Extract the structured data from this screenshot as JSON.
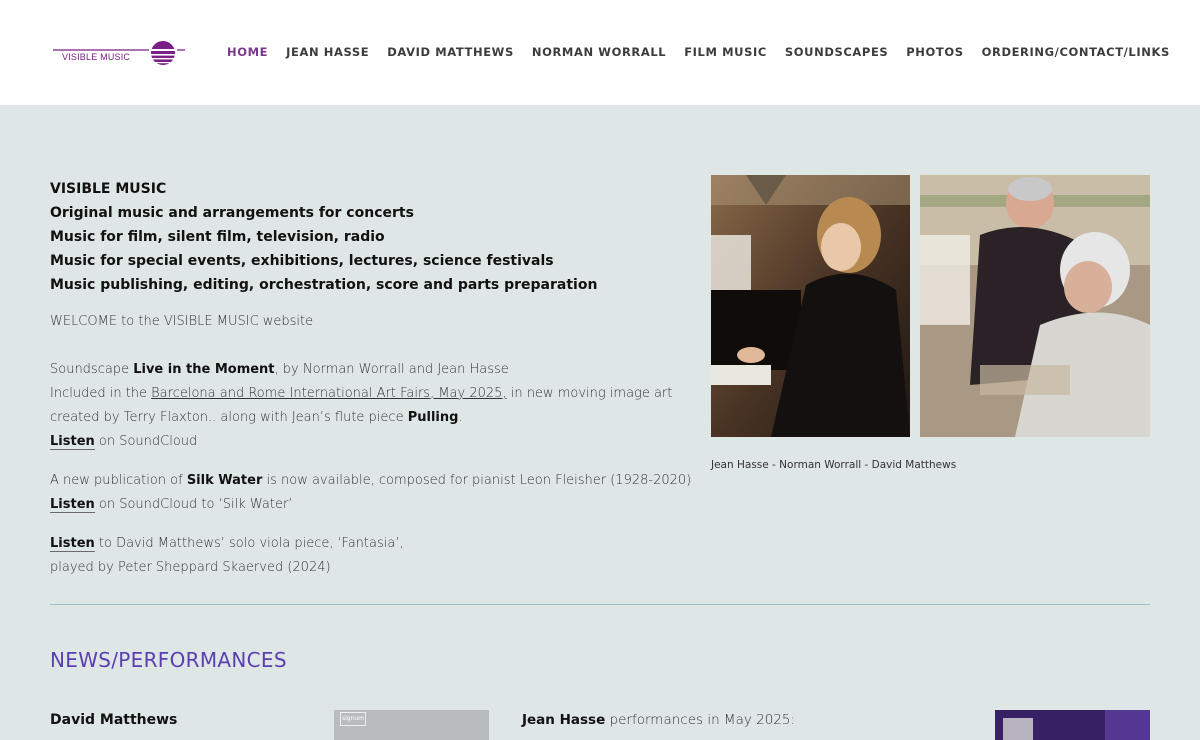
{
  "logo": {
    "text": "VISIBLE MUSIC",
    "color": "#7a1f86"
  },
  "nav": {
    "items": [
      {
        "label": "HOME",
        "active": true
      },
      {
        "label": "JEAN HASSE"
      },
      {
        "label": "DAVID MATTHEWS"
      },
      {
        "label": "NORMAN WORRALL"
      },
      {
        "label": "FILM MUSIC"
      },
      {
        "label": "SOUNDSCAPES"
      },
      {
        "label": "PHOTOS"
      },
      {
        "label": "ORDERING/CONTACT/LINKS"
      }
    ]
  },
  "intro": {
    "lines": [
      "VISIBLE MUSIC",
      "Original music and arrangements for concerts",
      "Music for film, silent film, television, radio",
      "Music for special events, exhibitions, lectures, science festivals",
      "Music publishing, editing, orchestration, score and parts preparation"
    ]
  },
  "welcome": "WELCOME to the VISIBLE MUSIC website",
  "soundscape": {
    "prefix": "Soundscape ",
    "title": "Live in the Moment",
    "suffix": ", by Norman Worrall and Jean Hasse",
    "line2_prefix": "Included in the ",
    "line2_link": "Barcelona and Rome International Art Fairs, May 2025,",
    "line2_suffix": " in new moving image art",
    "line3_prefix": "created by Terry Flaxton.. along with Jean’s flute piece ",
    "line3_bold": "Pulling",
    "line3_suffix": ".",
    "listen": "Listen",
    "listen_suffix": " on SoundCloud"
  },
  "silk_water": {
    "prefix": "A new publication of ",
    "title": "Silk Water",
    "suffix": " is now available, composed for pianist Leon Fleisher (1928-2020)",
    "listen": "Listen",
    "listen_suffix": " on SoundCloud to ‘Silk Water’"
  },
  "fantasia": {
    "listen": "Listen",
    "line1_suffix": " to David Matthews’ solo viola piece, ‘Fantasia’,",
    "line2": "played by Peter Sheppard Skaerved (2024)"
  },
  "photo_caption": "Jean Hasse - Norman Worrall - David Matthews",
  "news": {
    "title": "NEWS/PERFORMANCES",
    "col1_title": "David Matthews",
    "col2_bold": "Jean Hasse",
    "col2_suffix": " performances in May 2025:",
    "thumb1_label": "signum"
  },
  "colors": {
    "background": "#dfe7e6",
    "accent_purple": "#7a1f86",
    "news_title": "#5a3fb0",
    "divider": "#9cc0c9"
  }
}
